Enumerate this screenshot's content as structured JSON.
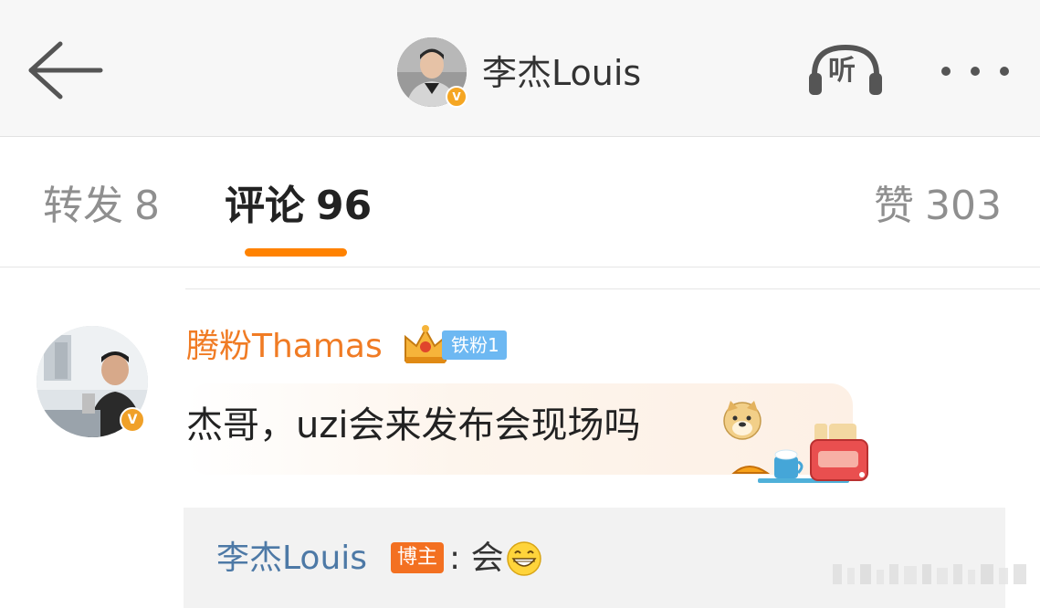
{
  "header": {
    "back_icon": "arrow-left-icon",
    "author_name": "李杰Louis",
    "verified_badge": "V",
    "listen_label": "听",
    "more_icon": "more-dots-icon"
  },
  "tabs": [
    {
      "label": "转发",
      "count": "8"
    },
    {
      "label": "评论",
      "count": "96"
    },
    {
      "label": "赞",
      "count": "303"
    }
  ],
  "active_tab": "评论",
  "comment": {
    "author": "腾粉Thamas",
    "fan_badge": "铁粉1",
    "verified_badge": "V",
    "text": "杰哥，uzi会来发布会现场吗",
    "emoji": "doge-emoji",
    "reply": {
      "author": "李杰Louis",
      "badge": "博主",
      "separator": ":",
      "text": "会",
      "emoji": "grin-emoji"
    }
  },
  "colors": {
    "accent": "#ff8200",
    "commenter_name": "#f07b24",
    "reply_author": "#4d79a6",
    "fan_badge": "#6db8f2",
    "op_badge": "#f37021"
  }
}
